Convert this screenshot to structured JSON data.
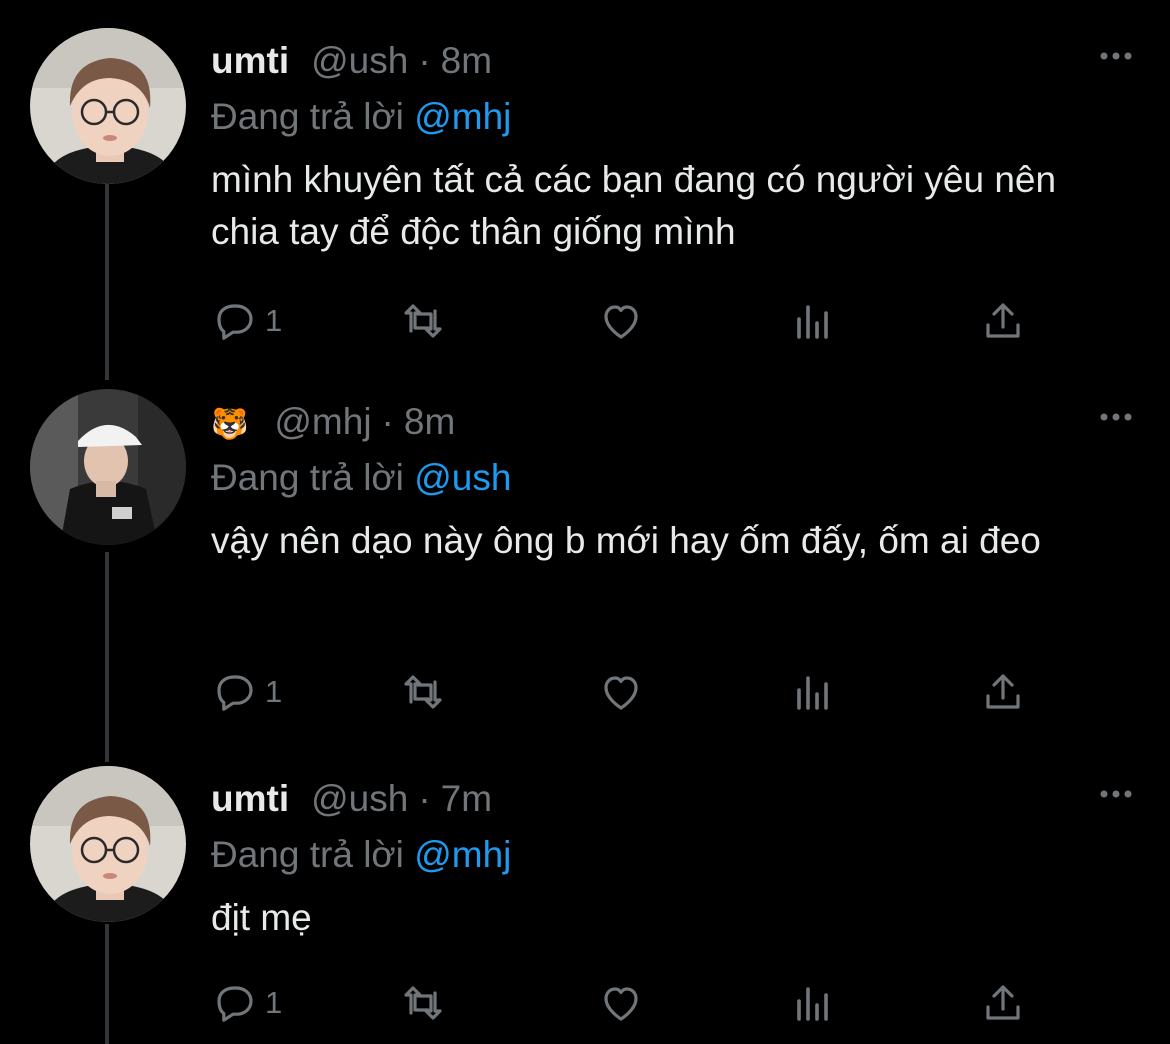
{
  "tweets": [
    {
      "display_name": "umti",
      "handle": "@ush",
      "separator": "·",
      "time": "8m",
      "replying_prefix": "Đang trả lời",
      "replying_to": "@mhj",
      "text": "mình khuyên tất cả các bạn đang có người yêu nên chia tay để độc thân giống mình",
      "reply_count": "1",
      "avatar": "glasses-person-avatar"
    },
    {
      "display_name": "🐯",
      "handle": "@mhj",
      "separator": "·",
      "time": "8m",
      "replying_prefix": "Đang trả lời",
      "replying_to": "@ush",
      "text": "vậy nên dạo này ông b mới hay ốm đấy, ốm ai đeo",
      "reply_count": "1",
      "avatar": "cap-person-avatar"
    },
    {
      "display_name": "umti",
      "handle": "@ush",
      "separator": "·",
      "time": "7m",
      "replying_prefix": "Đang trả lời",
      "replying_to": "@mhj",
      "text": "địt mẹ",
      "reply_count": "1",
      "avatar": "glasses-person-avatar"
    }
  ],
  "icons": {
    "reply": "reply-icon",
    "retweet": "retweet-icon",
    "like": "heart-icon",
    "views": "views-icon",
    "share": "share-icon",
    "more": "more-icon"
  },
  "colors": {
    "background": "#000000",
    "text": "#e7e9ea",
    "muted": "#71767b",
    "link": "#1d9bf0",
    "thread_line": "#333639"
  }
}
